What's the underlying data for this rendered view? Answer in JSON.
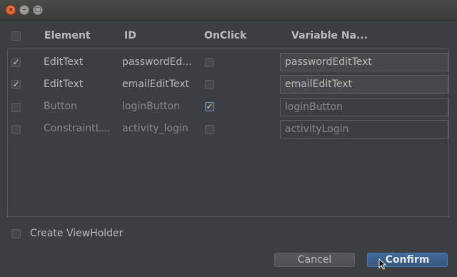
{
  "window": {
    "close_glyph": "×",
    "min_glyph": "–",
    "max_glyph": "□"
  },
  "headers": {
    "element": "Element",
    "id": "ID",
    "onclick": "OnClick",
    "variable_name": "Variable Na..."
  },
  "rows": [
    {
      "checked": true,
      "element": "EditText",
      "id": "passwordEd...",
      "onclick": false,
      "variable": "passwordEditText"
    },
    {
      "checked": true,
      "element": "EditText",
      "id": "emailEditText",
      "onclick": false,
      "variable": "emailEditText"
    },
    {
      "checked": false,
      "element": "Button",
      "id": "loginButton",
      "onclick": true,
      "variable": "loginButton"
    },
    {
      "checked": false,
      "element": "ConstraintL...",
      "id": "activity_login",
      "onclick": false,
      "variable": "activityLogin"
    }
  ],
  "check_glyph": "✓",
  "create_viewholder_label": "Create ViewHolder",
  "buttons": {
    "cancel": "Cancel",
    "confirm": "Confirm"
  }
}
